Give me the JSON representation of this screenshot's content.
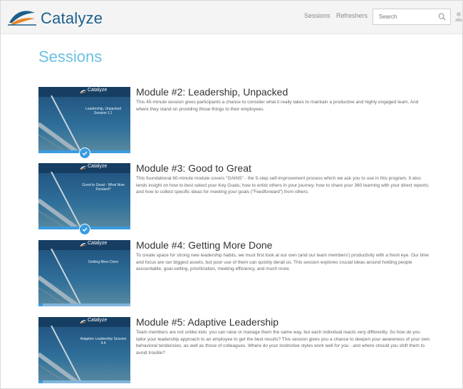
{
  "header": {
    "brand": "Catalyze",
    "nav": [
      "Sessions",
      "Refreshers"
    ],
    "search_placeholder": "Search"
  },
  "page": {
    "title": "Sessions"
  },
  "sessions": [
    {
      "title": "Module #2: Leadership, Unpacked",
      "description": "This 45-minute session gives participants a chance to consider what it really takes to maintain a productive and highly engaged team. And where they stand on providing those things to their employees.",
      "thumb_caption": "Leadership, Unpacked Session 1.1",
      "progress": 1,
      "completed": true
    },
    {
      "title": "Module #3: Good to Great",
      "description": "This foundational 60-minute module covers \"GAINS\" - the 5-step self-improvement process which we ask you to use in this program. It also lends insight on how to best select your Key Goals; how to enlist others in your journey; how to share your 360 learning with your direct reports; and how to collect specific ideas for meeting your goals (\"Feedforward\") from others.",
      "thumb_caption": "Good to Great - What Now Forward?",
      "progress": 1,
      "completed": true
    },
    {
      "title": "Module #4: Getting More Done",
      "description": "To create space for strong new leadership habits, we must first look at our own (and our team members') productivity with a fresh eye. Our time and focus are our biggest assets, but poor use of them can quickly derail us. This session explores crucial ideas around holding people accountable, goal-setting, prioritization, meeting efficiency, and much more.",
      "thumb_caption": "Getting More Done",
      "progress": 0.05,
      "completed": false
    },
    {
      "title": "Module #5: Adaptive Leadership",
      "description": "Team members are not unlike kids: you can raise or manage them the same way, but each individual reacts very differently. So how do you tailor your leadership approach to an employee to get the best results? This session gives you a chance to deepen your awareness of your own behavioral tendencies, as well as those of colleagues. Where do your instinctive styles work well for you - and where should you shift them to avoid trouble?",
      "thumb_caption": "Adaptive Leadership Session 4.4",
      "progress": 0.05,
      "completed": false
    }
  ],
  "colors": {
    "brand": "#1b5f8c",
    "title": "#6cc0e3",
    "accent": "#3a9be0"
  },
  "icons": {
    "search": "search-icon",
    "user": "user-icon",
    "check": "check-icon",
    "logo": "sail-logo-icon"
  }
}
